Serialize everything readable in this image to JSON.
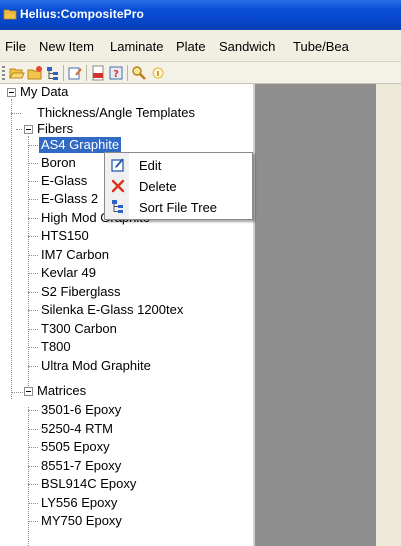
{
  "window": {
    "title": "Helius:CompositePro"
  },
  "menu": {
    "items": [
      {
        "label": "File"
      },
      {
        "label": "New Item"
      },
      {
        "label": "Laminate"
      },
      {
        "label": "Plate"
      },
      {
        "label": "Sandwich"
      },
      {
        "label": "Tube/Bea"
      }
    ]
  },
  "toolbar": {
    "buttons": [
      {
        "icon": "open-folder-icon"
      },
      {
        "icon": "new-folder-icon"
      },
      {
        "icon": "sort-tree-icon"
      },
      {
        "icon": "edit-properties-icon"
      },
      {
        "icon": "pdf-document-icon"
      },
      {
        "icon": "help-icon"
      },
      {
        "icon": "search-icon"
      },
      {
        "icon": "info-icon"
      }
    ]
  },
  "tree": {
    "root": "My Data",
    "templates": "Thickness/Angle Templates",
    "fibers_label": "Fibers",
    "fibers": [
      "AS4 Graphite",
      "Boron",
      "E-Glass",
      "E-Glass 2",
      "High Mod Graphite",
      "HTS150",
      "IM7 Carbon",
      "Kevlar 49",
      "S2 Fiberglass",
      "Silenka E-Glass 1200tex",
      "T300 Carbon",
      "T800",
      "Ultra Mod Graphite"
    ],
    "matrices_label": "Matrices",
    "matrices": [
      "3501-6 Epoxy",
      "5250-4 RTM",
      "5505 Epoxy",
      "8551-7 Epoxy",
      "BSL914C Epoxy",
      "LY556 Epoxy",
      "MY750 Epoxy"
    ],
    "selected": "AS4 Graphite"
  },
  "context_menu": {
    "items": [
      {
        "label": "Edit",
        "icon": "edit-icon"
      },
      {
        "label": "Delete",
        "icon": "delete-icon"
      },
      {
        "label": "Sort File Tree",
        "icon": "sort-tree-icon"
      }
    ]
  },
  "colors": {
    "titlebar": "#0a50d8",
    "selection": "#316ac5",
    "workspace": "#8e8e8e",
    "menubar": "#f1efe2"
  }
}
